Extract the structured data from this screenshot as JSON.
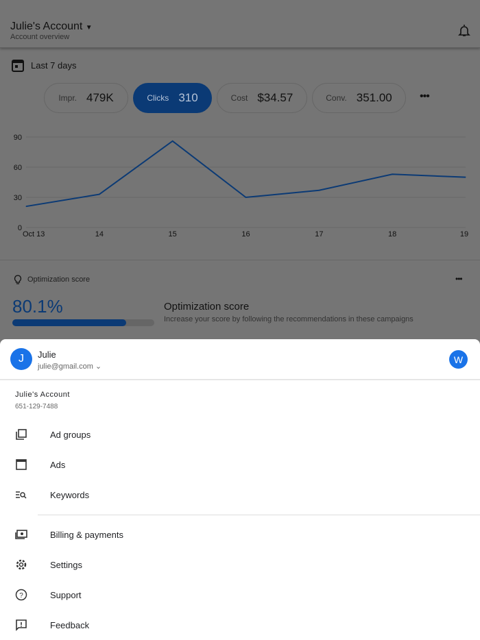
{
  "header": {
    "title": "Julie's Account",
    "subtitle": "Account overview"
  },
  "date_range": "Last 7 days",
  "metrics": [
    {
      "label": "Impr.",
      "value": "479K"
    },
    {
      "label": "Clicks",
      "value": "310",
      "selected": true
    },
    {
      "label": "Cost",
      "value": "$34.57"
    },
    {
      "label": "Conv.",
      "value": "351.00"
    }
  ],
  "chart_data": {
    "type": "line",
    "categories": [
      "Oct 13",
      "14",
      "15",
      "16",
      "17",
      "18",
      "19"
    ],
    "values": [
      21,
      33,
      86,
      30,
      37,
      53,
      50
    ],
    "yticks": [
      "0",
      "30",
      "60",
      "90"
    ],
    "ylim": [
      0,
      90
    ],
    "series_color": "#1457c4"
  },
  "optimization": {
    "header": "Optimization score",
    "score": "80.1%",
    "fraction": 0.801,
    "title": "Optimization score",
    "desc": "Increase your score by following the recommendations in these campaigns"
  },
  "sheet": {
    "avatar": "J",
    "name": "Julie",
    "email": "julie@gmail.com",
    "right_avatar": "W",
    "account_name": "Julie's Account",
    "account_id": "651-129-7488",
    "items": [
      "Ad groups",
      "Ads",
      "Keywords",
      "Billing & payments",
      "Settings",
      "Support",
      "Feedback"
    ]
  }
}
